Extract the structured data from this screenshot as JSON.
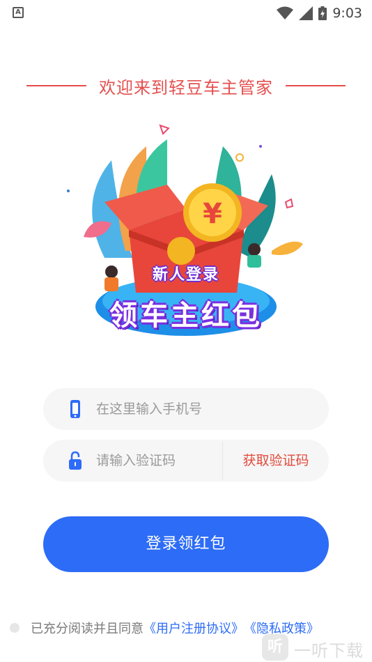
{
  "status_bar": {
    "left_icon": "A",
    "time": "9:03",
    "icons": [
      "wifi-icon",
      "signal-icon",
      "battery-charging-icon"
    ]
  },
  "welcome": {
    "title": "欢迎来到轻豆车主管家"
  },
  "hero": {
    "title_small": "新人登录",
    "title_large": "领车主红包",
    "coin_symbol": "¥"
  },
  "form": {
    "phone_placeholder": "在这里输入手机号",
    "code_placeholder": "请输入验证码",
    "get_code_label": "获取验证码"
  },
  "login": {
    "label": "登录领红包"
  },
  "agreement": {
    "prefix": "已充分阅读并且同意",
    "user_agreement": "《用户注册协议》",
    "privacy_policy": "《隐私政策》"
  },
  "watermark": {
    "logo": "听",
    "text": "一听下载"
  },
  "colors": {
    "accent_blue": "#2d6cf6",
    "accent_red": "#e55050",
    "field_bg": "#f6f6f6"
  }
}
